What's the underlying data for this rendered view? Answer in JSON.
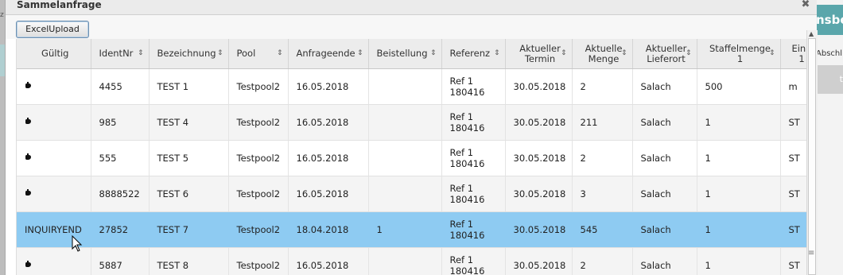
{
  "background": {
    "teal_fragment": "nsbe",
    "text_fragment": "Abschl",
    "grey_fragment": "t"
  },
  "dialog": {
    "title": "Sammelanfrage",
    "close_glyph": "✖",
    "excel_button": "ExcelUpload"
  },
  "grid": {
    "columns": [
      {
        "l1": "Gültig",
        "l2": ""
      },
      {
        "l1": "IdentNr",
        "l2": ""
      },
      {
        "l1": "Bezeichnung",
        "l2": ""
      },
      {
        "l1": "Pool",
        "l2": ""
      },
      {
        "l1": "Anfrageende",
        "l2": ""
      },
      {
        "l1": "Beistellung",
        "l2": ""
      },
      {
        "l1": "Referenz",
        "l2": ""
      },
      {
        "l1": "Aktueller",
        "l2": "Termin"
      },
      {
        "l1": "Aktuelle",
        "l2": "Menge"
      },
      {
        "l1": "Aktueller",
        "l2": "Lieferort"
      },
      {
        "l1": "Staffelmenge",
        "l2": "1"
      },
      {
        "l1": "Einh",
        "l2": "1"
      }
    ],
    "rows": [
      {
        "gueltig": "",
        "ident": "4455",
        "bez": "TEST 1",
        "pool": "Testpool2",
        "ende": "16.05.2018",
        "beist": "",
        "ref1": "Ref 1",
        "ref2": "180416",
        "termin": "30.05.2018",
        "menge": "2",
        "ort": "Salach",
        "staffel": "500",
        "einh": "m"
      },
      {
        "gueltig": "",
        "ident": "985",
        "bez": "TEST 4",
        "pool": "Testpool2",
        "ende": "16.05.2018",
        "beist": "",
        "ref1": "Ref 1",
        "ref2": "180416",
        "termin": "30.05.2018",
        "menge": "211",
        "ort": "Salach",
        "staffel": "1",
        "einh": "ST"
      },
      {
        "gueltig": "",
        "ident": "555",
        "bez": "TEST 5",
        "pool": "Testpool2",
        "ende": "16.05.2018",
        "beist": "",
        "ref1": "Ref 1",
        "ref2": "180416",
        "termin": "30.05.2018",
        "menge": "2",
        "ort": "Salach",
        "staffel": "1",
        "einh": "ST"
      },
      {
        "gueltig": "",
        "ident": "8888522",
        "bez": "TEST 6",
        "pool": "Testpool2",
        "ende": "16.05.2018",
        "beist": "",
        "ref1": "Ref 1",
        "ref2": "180416",
        "termin": "30.05.2018",
        "menge": "3",
        "ort": "Salach",
        "staffel": "1",
        "einh": "ST"
      },
      {
        "gueltig": "INQUIRYEND",
        "ident": "27852",
        "bez": "TEST 7",
        "pool": "Testpool2",
        "ende": "18.04.2018",
        "beist": "1",
        "ref1": "Ref 1",
        "ref2": "180416",
        "termin": "30.05.2018",
        "menge": "545",
        "ort": "Salach",
        "staffel": "1",
        "einh": "ST"
      },
      {
        "gueltig": "",
        "ident": "5887",
        "bez": "TEST 8",
        "pool": "Testpool2",
        "ende": "16.05.2018",
        "beist": "",
        "ref1": "Ref 1",
        "ref2": "180416",
        "termin": "30.05.2018",
        "menge": "2",
        "ort": "Salach",
        "staffel": "1",
        "einh": "ST"
      }
    ],
    "selected_row": 4
  }
}
